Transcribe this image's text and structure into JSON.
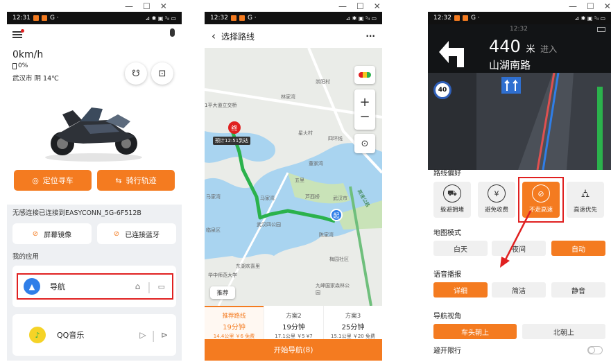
{
  "window_controls": {
    "minimize": "—",
    "maximize": "☐",
    "close": "✕"
  },
  "phone1": {
    "status": {
      "time": "12:31",
      "carrier": "G ·",
      "right": "⊿ ✱ ▣ ⁵ₗₗ ▭"
    },
    "speed": "0km/h",
    "battery": "0%",
    "weather": "武汉市 阴 14℃",
    "locate_btn": "定位寻车",
    "track_btn": "骑行轨迹",
    "connection_text": "无感连接已连接到EASYCONN_5G-6F512B",
    "screen_mirror": "屏幕镜像",
    "bluetooth": "已连接蓝牙",
    "my_apps": "我的应用",
    "apps": [
      {
        "name": "导航"
      },
      {
        "name": "QQ音乐"
      }
    ]
  },
  "phone2": {
    "status": {
      "time": "12:32",
      "carrier": "G ·",
      "right": "⊿ ✱ ▣ ⁵ₗₗ ▭"
    },
    "title": "选择路线",
    "more": "···",
    "map_labels": {
      "l1": "崇阳村",
      "l2": "林家湾",
      "l3": "1平大道立交桥",
      "l4": "星火村",
      "l5": "四环线",
      "l6": "董家湾",
      "l7": "五里",
      "l8": "芦西桥",
      "l9": "武汉市",
      "l10": "马家湾",
      "l11": "武汉四公园",
      "l12": "陈家湾",
      "l13": "梅园社区",
      "l14": "东湖欢喜里",
      "l15": "华中师范大学",
      "l16": "高速公路",
      "l17": "九峰国家森林公园",
      "l18": "临泉区",
      "l19": "马家湾"
    },
    "end_marker": "终",
    "start_marker": "起",
    "eta": "预计12:51到达",
    "recommend": "推荐",
    "plans": [
      {
        "label": "推荐路线",
        "time": "19分钟",
        "detail": "14.4公里 ￥6 免费"
      },
      {
        "label": "方案2",
        "time": "19分钟",
        "detail": "17.1公里 ￥5 ¥7"
      },
      {
        "label": "方案3",
        "time": "25分钟",
        "detail": "15.1公里 ￥20 免费"
      }
    ],
    "start_nav": "开始导航(8)"
  },
  "phone3": {
    "status": {
      "time": "12:32",
      "carrier": "G ·",
      "right": "⊿ ✱ ▣ ⁵ₗₗ ▭"
    },
    "clock": "12:32",
    "distance": "440",
    "unit": "米",
    "enter": "进入",
    "road": "山湖南路",
    "speed_limit": "40",
    "sections": {
      "route_pref": "路线偏好",
      "map_mode": "地图模式",
      "voice": "语音播报",
      "view": "导航视角",
      "avoid": "避开限行"
    },
    "prefs": [
      {
        "label": "躲避拥堵",
        "icon": "⛟",
        "active": false
      },
      {
        "label": "避免收费",
        "icon": "¥",
        "active": false
      },
      {
        "label": "不走高速",
        "icon": "⊘",
        "active": true
      },
      {
        "label": "高速优先",
        "icon": "⛼",
        "active": false
      }
    ],
    "map_modes": [
      "白天",
      "夜间",
      "自动"
    ],
    "voice_modes": [
      "详细",
      "简洁",
      "静音"
    ],
    "views": [
      "车头朝上",
      "北朝上"
    ]
  },
  "colors": {
    "accent": "#f47b20",
    "highlight": "#e02020",
    "route": "#2bb24c"
  }
}
